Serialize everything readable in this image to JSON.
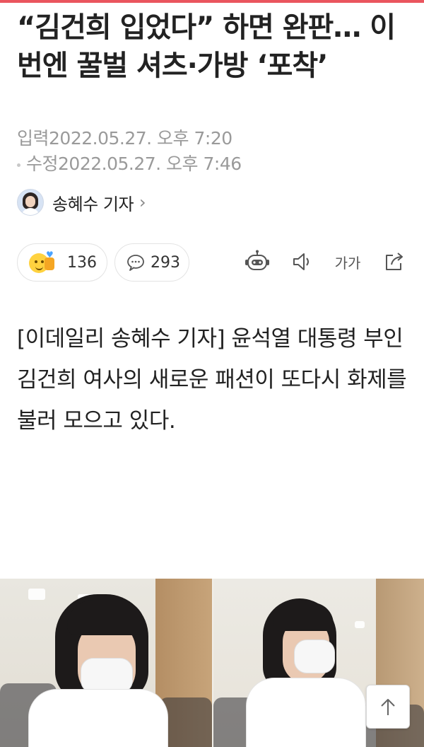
{
  "article": {
    "headline": "“김건희 입었다” 하면 완판… 이번엔 꿀벌 셔츠·가방 ‘포착’",
    "published_label": "입력",
    "published": "2022.05.27. 오후 7:20",
    "modified_label": "수정",
    "modified": "2022.05.27. 오후 7:46",
    "author": "송혜수 기자",
    "author_chevron": "›",
    "body": "[이데일리 송혜수 기자] 윤석열 대통령 부인 김건희 여사의 새로운 패션이 또다시 화제를 불러 모으고 있다."
  },
  "reactions": {
    "like_count": "136",
    "comment_count": "293"
  },
  "tools": {
    "font_size_label": "가가",
    "icons": [
      "robot-summary-icon",
      "speaker-icon",
      "font-size-icon",
      "share-icon"
    ]
  },
  "colors": {
    "accent": "#e8424c",
    "meta_gray": "#9a9a9a",
    "text": "#222222"
  }
}
